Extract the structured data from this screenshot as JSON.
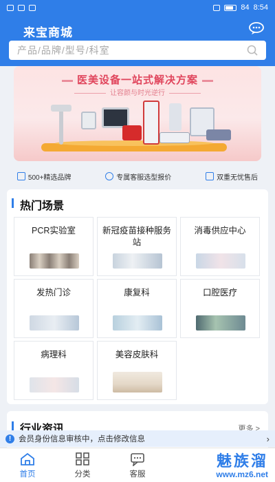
{
  "status_bar": {
    "time": "8:54",
    "battery": "84"
  },
  "header": {
    "title": "来宝商城",
    "search_placeholder": "产品/品牌/型号/科室"
  },
  "banner": {
    "title": "医美设备一站式解决方案",
    "subtitle": "让容颜与时光逆行"
  },
  "features": [
    {
      "label": "500+精选品牌",
      "icon": "bookmark-icon"
    },
    {
      "label": "专属客服选型报价",
      "icon": "headset-icon"
    },
    {
      "label": "双重无忧售后",
      "icon": "shield-icon"
    }
  ],
  "scenes": {
    "title": "热门场景",
    "items": [
      {
        "name": "PCR实验室"
      },
      {
        "name": "新冠疫苗接种服务站"
      },
      {
        "name": "消毒供应中心"
      },
      {
        "name": "发热门诊"
      },
      {
        "name": "康复科"
      },
      {
        "name": "口腔医疗"
      },
      {
        "name": "病理科"
      },
      {
        "name": "美容皮肤科"
      }
    ]
  },
  "news": {
    "title": "行业资讯",
    "more": "更多 >"
  },
  "notice": {
    "text": "会员身份信息审核中，点击修改信息"
  },
  "tabbar": [
    {
      "label": "首页",
      "icon": "home-icon"
    },
    {
      "label": "分类",
      "icon": "grid-icon"
    },
    {
      "label": "客服",
      "icon": "chat-icon"
    }
  ],
  "watermark": {
    "brand": "魅族溜",
    "url": "www.mz6.net"
  },
  "colors": {
    "primary": "#2f7ee8",
    "banner_accent": "#e0455c"
  }
}
